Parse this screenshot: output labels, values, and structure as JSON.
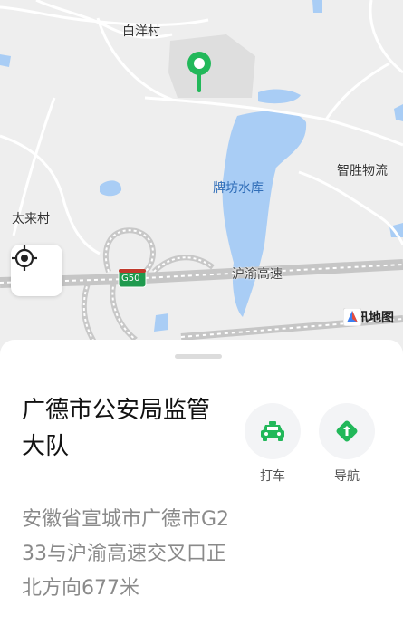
{
  "map": {
    "labels": {
      "village_top": "白洋村",
      "reservoir": "牌坊水库",
      "logistics": "智胜物流",
      "village_left": "太来村",
      "expressway": "沪渝高速",
      "highway_shield": "G50"
    },
    "provider": "腾讯地图",
    "colors": {
      "land": "#eeeeee",
      "water": "#a9cdf5",
      "road": "#ffffff",
      "pin": "#22b85a"
    }
  },
  "place": {
    "name": "广德市公安局监管大队",
    "address": "安徽省宣城市广德市G233与沪渝高速交叉口正北方向677米"
  },
  "actions": {
    "taxi": {
      "label": "打车",
      "icon": "taxi-icon",
      "color": "#22b85a"
    },
    "navigate": {
      "label": "导航",
      "icon": "navigation-icon",
      "color": "#22b85a"
    }
  }
}
